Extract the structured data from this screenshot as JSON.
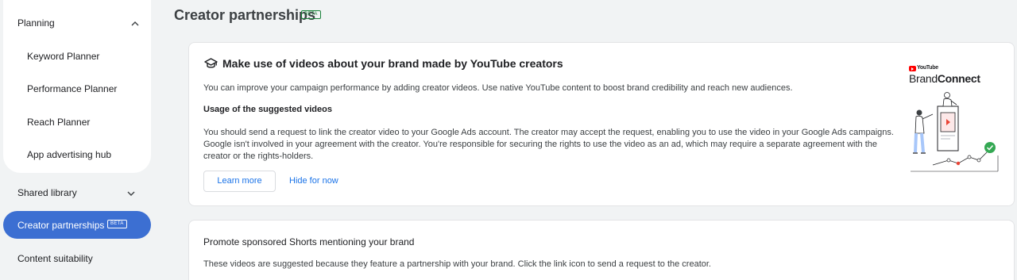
{
  "sidebar": {
    "planning": {
      "label": "Planning",
      "items": [
        {
          "label": "Keyword Planner"
        },
        {
          "label": "Performance Planner"
        },
        {
          "label": "Reach Planner"
        },
        {
          "label": "App advertising hub"
        }
      ]
    },
    "shared_library": {
      "label": "Shared library"
    },
    "creator_partnerships": {
      "label": "Creator partnerships",
      "badge": "BETA"
    },
    "content_suitability": {
      "label": "Content suitability"
    }
  },
  "page": {
    "title": "Creator partnerships",
    "badge": "BETA"
  },
  "card1": {
    "heading": "Make use of videos about your brand made by YouTube creators",
    "paragraph1": "You can improve your campaign performance by adding creator videos. Use native YouTube content to boost brand credibility and reach new audiences.",
    "subheading": "Usage of the suggested videos",
    "paragraph2": "You should send a request to link the creator video to your Google Ads account. The creator may accept the request, enabling you to use the video in your Google Ads campaigns. Google isn't involved in your agreement with the creator. You're responsible for securing the rights to use the video as an ad, which may require a separate agreement with the creator or the rights-holders.",
    "learn_more": "Learn more",
    "hide_for_now": "Hide for now",
    "brand_logo_text": "YouTube",
    "brand_name_light": "Brand",
    "brand_name_bold": "Connect"
  },
  "card2": {
    "heading": "Promote sponsored Shorts mentioning your brand",
    "paragraph": "These videos are suggested because they feature a partnership with your brand. Click the link icon to send a request to the creator."
  },
  "colors": {
    "accent": "#3c6fd2",
    "link": "#1a73e8",
    "beta_green": "#188038",
    "background": "#f1f3f4"
  },
  "icons": {
    "planning_toggle": "chevron-up-icon",
    "shared_library_toggle": "chevron-down-icon",
    "card1_heading": "graduation-cap-icon"
  }
}
